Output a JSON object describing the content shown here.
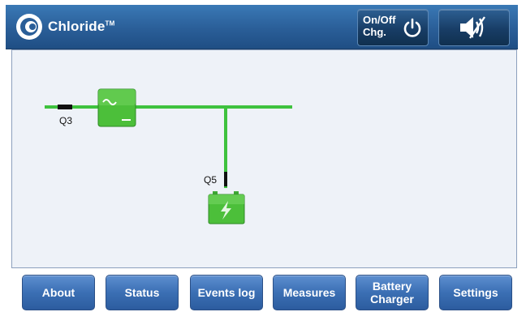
{
  "header": {
    "brand": "Chloride",
    "trademark": "TM",
    "onoff_label": "On/Off\nChg.",
    "onoff_icon": "power-icon",
    "mute_icon": "speaker-muted-icon",
    "background": "#2a5e98"
  },
  "diagram": {
    "breaker_q3": "Q3",
    "breaker_q5": "Q5",
    "line_color": "#3ec23e",
    "components": [
      "rectifier-icon",
      "battery-icon"
    ]
  },
  "nav": {
    "about": "About",
    "status": "Status",
    "events_log": "Events log",
    "measures": "Measures",
    "battery_charger": "Battery\nCharger",
    "settings": "Settings"
  }
}
